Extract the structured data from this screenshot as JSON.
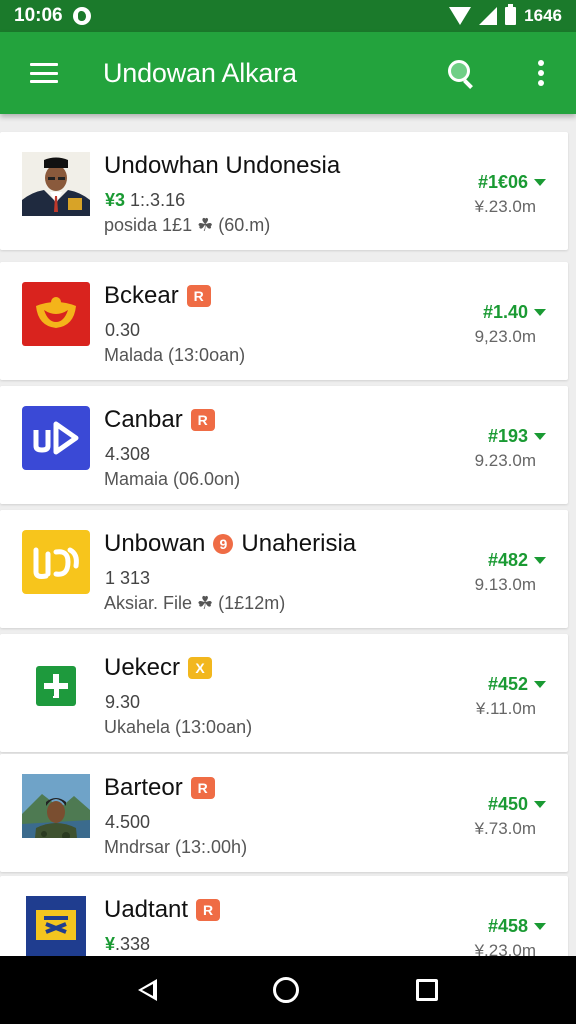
{
  "status_bar": {
    "time": "10:06",
    "clock_right": "1646"
  },
  "app_bar": {
    "title": "Undowan Alkara"
  },
  "icons": {
    "menu": "hamburger-menu-icon",
    "search": "search-icon",
    "more": "more-vert-icon",
    "back": "back-triangle-icon",
    "home": "home-circle-icon",
    "recent": "recent-square-icon"
  },
  "colors": {
    "app_bar": "#23a33d",
    "status_bar": "#1b7a2b",
    "accent_green": "#1a9a33",
    "badge_orange": "#ef6c45",
    "badge_yellow": "#f2b71e"
  },
  "items": [
    {
      "name": "Undowhan Undonesia",
      "badge": "",
      "line2_prefix": "¥3",
      "line2": "1:.3.16",
      "line3": "posida 1£1 ☘ (60.m)",
      "price": "#1€06",
      "size": "¥.23.0m"
    },
    {
      "name": "Bckear",
      "badge": "R",
      "line2_prefix": "",
      "line2": "0.30",
      "line3": "Malada (13:0oan)",
      "price": "#1.40",
      "size": "9,23.0m"
    },
    {
      "name": "Canbar",
      "badge": "R",
      "line2_prefix": "",
      "line2": "4.308",
      "line3": "Mamaia (06.0on)",
      "price": "#193",
      "size": "9.23.0m"
    },
    {
      "name": "Unbowan",
      "name2": "Unaherisia",
      "badge": "9",
      "line2_prefix": "",
      "line2": "1  313",
      "line3": "Aksiar. File ☘ (1£12m)",
      "price": "#482",
      "size": "9.13.0m"
    },
    {
      "name": "Uekecr",
      "badge": "X",
      "line2_prefix": "",
      "line2": "9.30",
      "line3": "Ukahela (13:0oan)",
      "price": "#452",
      "size": "¥.11.0m"
    },
    {
      "name": "Barteor",
      "badge": "R",
      "line2_prefix": "",
      "line2": "4.500",
      "line3": "Mndrsar (13:.00h)",
      "price": "#450",
      "size": "¥.73.0m"
    },
    {
      "name": "Uadtant",
      "badge": "R",
      "line2_prefix": "¥",
      "line2": ".338",
      "line3": "",
      "price": "#458",
      "size": "¥.23.0m"
    }
  ]
}
